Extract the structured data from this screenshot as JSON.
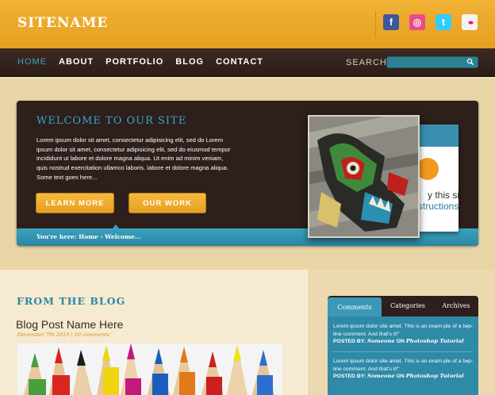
{
  "site": {
    "name": "SITENAME"
  },
  "social": [
    {
      "name": "facebook",
      "glyph": "f",
      "color": "#3b5998"
    },
    {
      "name": "dribbble",
      "glyph": "◎",
      "color": "#ea4c89"
    },
    {
      "name": "twitter",
      "glyph": "t",
      "color": "#33ccff"
    },
    {
      "name": "flickr",
      "glyph": "••",
      "color": "#ff0084"
    }
  ],
  "nav": {
    "items": [
      "HOME",
      "ABOUT",
      "PORTFOLIO",
      "BLOG",
      "CONTACT"
    ],
    "active": "HOME",
    "search_label": "SEARCH",
    "search_placeholder": ""
  },
  "hero": {
    "title": "WELCOME TO OUR SITE",
    "text": "Lorem ipsum dolor sit amet, consectetur adipisicing elit, sed do Lorem ipsum dolor sit amet, consectetur adipisicing elit, sed do eiusmod tempor incididunt ut labore et dolore magna aliqua. Ut enim ad minim veniam, quis nostrud exercitation ullamco laboris. labore et dolore magna aliqua. Some text goes here...",
    "learn_more": "LEARN MORE",
    "our_work": "OUR WORK",
    "breadcrumb": "You're here: Home › Welcome...",
    "slide_back_line1": "y this sit",
    "slide_back_line2": "structions"
  },
  "blog": {
    "heading": "FROM THE BLOG",
    "post_title": "Blog Post Name Here",
    "post_meta": "December 7th 2010 | 10 comments"
  },
  "widget": {
    "tabs": [
      "Comments",
      "Categories",
      "Archives"
    ],
    "comments": [
      {
        "text": "Lorem ipsum dolor site amet. This is an exam-ple of a twp-line comment. And that's it!\"",
        "posted_by_label": "POSTED BY:",
        "author": "Someone",
        "on_label": "ON",
        "post": "Photoshop Tutorial"
      },
      {
        "text": "Lorem ipsum dolor site amet. This is an exam-ple of a twp-line comment. And that's it!\"",
        "posted_by_label": "POSTED BY:",
        "author": "Someone",
        "on_label": "ON",
        "post": "Photoshop Tutorial"
      }
    ]
  }
}
